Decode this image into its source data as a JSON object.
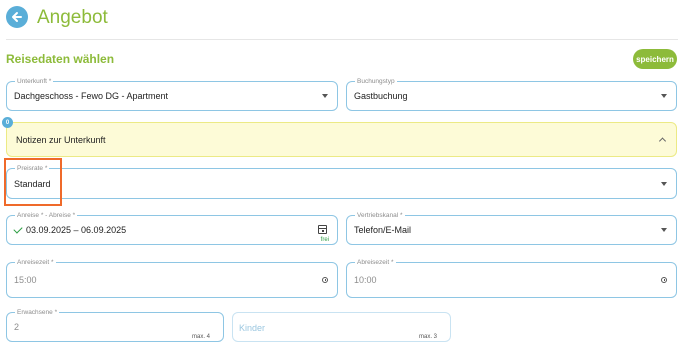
{
  "header": {
    "title": "Angebot"
  },
  "section": {
    "title": "Reisedaten wählen",
    "save_label": "speichern"
  },
  "accommodation": {
    "label": "Unterkunft *",
    "value": "Dachgeschoss - Fewo DG - Apartment"
  },
  "booking_type": {
    "label": "Buchungstyp",
    "value": "Gastbuchung"
  },
  "notes": {
    "badge": "0",
    "label": "Notizen zur Unterkunft"
  },
  "rate": {
    "label": "Preisrate *",
    "value": "Standard"
  },
  "dates": {
    "label": "Anreise * - Abreise *",
    "value": "03.09.2025 – 06.09.2025",
    "status": "frei"
  },
  "channel": {
    "label": "Vertriebskanal *",
    "value": "Telefon/E-Mail"
  },
  "arrival_time": {
    "label": "Anreisezeit *",
    "value": "15:00"
  },
  "departure_time": {
    "label": "Abreisezeit *",
    "value": "10:00"
  },
  "adults": {
    "label": "Erwachsene *",
    "value": "2",
    "max": "max. 4"
  },
  "children": {
    "placeholder": "Kinder",
    "max": "max. 3"
  },
  "colors": {
    "accent_green": "#8dbb3a",
    "accent_blue": "#5aaed8",
    "highlight": "#ef6a2a"
  },
  "icons": {
    "back": "arrow-left-icon",
    "check": "check-icon",
    "calendar": "calendar-icon",
    "clock": "clock-icon"
  }
}
